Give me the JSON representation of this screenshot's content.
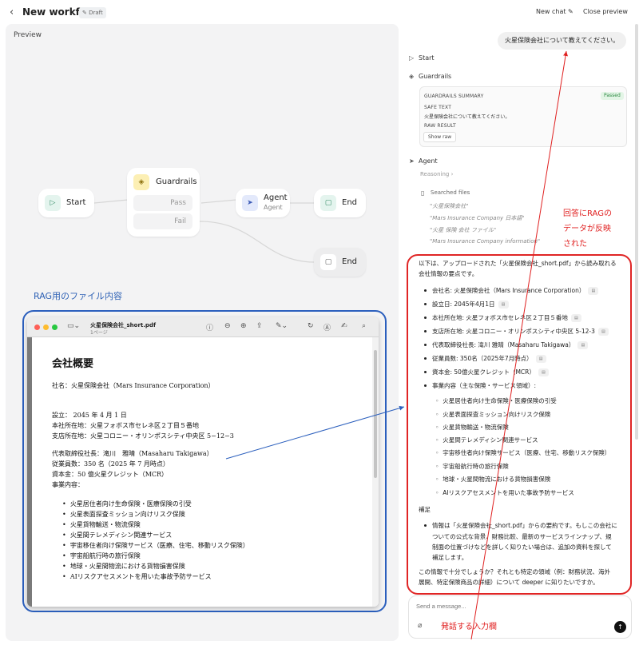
{
  "header": {
    "back_icon": "chevron-left-icon",
    "title": "New workflow",
    "draft_badge": "Draft",
    "new_chat": "New chat",
    "close_preview": "Close preview"
  },
  "preview": {
    "label": "Preview",
    "nodes": {
      "start": "Start",
      "guardrails": "Guardrails",
      "pass": "Pass",
      "fail": "Fail",
      "agent": "Agent",
      "agent_sub": "Agent",
      "end1": "End",
      "end2": "End"
    },
    "rag_label": "RAG用のファイル内容"
  },
  "pdf": {
    "filename": "火星保険会社_short.pdf",
    "pages": "1ページ",
    "title": "会社概要",
    "company": "社名：火星保険会社（Mars Insurance Corporation）",
    "established": "設立： 2045 年 4 月 1 日",
    "hq": "本社所在地：火星フォボス市セレネ区２丁目５番地",
    "branch": "支店所在地：火星コロニー・オリンポスシティ中央区 5−12−3",
    "ceo": "代表取締役社長：滝川　雅晴（Masaharu Takigawa）",
    "employees": "従業員数：350 名（2025 年 7 月時点）",
    "capital": "資本金：50 億火星クレジット（MCR）",
    "business_head": "事業内容：",
    "business": [
      "火星居住者向け生命保険・医療保険の引受",
      "火星表面探査ミッション向けリスク保険",
      "火星貨物輸送・物流保険",
      "火星間テレメディシン関連サービス",
      "宇宙移住者向け保険サービス（医療、住宅、移動リスク保険）",
      "宇宙船航行時の旅行保険",
      "地球・火星間物流における貨物損害保険",
      "AIリスクアセスメントを用いた事故予防サービス"
    ]
  },
  "chat": {
    "user_message": "火星保険会社について教えてください。",
    "start": "Start",
    "guardrails": "Guardrails",
    "summary_title": "GUARDRAILS SUMMARY",
    "passed": "Passed",
    "safe_text_label": "SAFE TEXT",
    "safe_text": "火星保険会社について教えてください。",
    "raw_result_label": "RAW RESULT",
    "show_raw": "Show raw",
    "agent": "Agent",
    "reasoning": "Reasoning",
    "searched_files": "Searched files",
    "queries": [
      "\"火星保険会社\"",
      "\"Mars Insurance Company 日本語\"",
      "\"火星 保険 会社 ファイル\"",
      "\"Mars Insurance Company information\""
    ],
    "annotation_answer": [
      "回答にRAGの",
      "データが反映",
      "された"
    ],
    "answer_intro": [
      "以下は、アップロードされた「火星保険会社_short.pdf」から読み取れる",
      "会社情報の要点です。"
    ],
    "answer_items": [
      "会社名: 火星保険会社（Mars Insurance Corporation）",
      "設立日: 2045年4月1日",
      "本社所在地: 火星フォボス市セレネ区２丁目５番地",
      "支店所在地: 火星コロニー・オリンポスシティ中央区 5-12-3",
      "代表取締役社長: 滝川 雅晴（Masaharu Takigawa）",
      "従業員数: 350名（2025年7月時点）",
      "資本金: 50億火星クレジット（MCR）",
      "事業内容（主な保険・サービス領域）:"
    ],
    "answer_sub_items": [
      "火星居住者向け生命保険・医療保険の引受",
      "火星表面探査ミッション向けリスク保険",
      "火星貨物輸送・物流保険",
      "火星間テレメディシン関連サービス",
      "宇宙移住者向け保険サービス（医療、住宅、移動リスク保険）",
      "宇宙船航行時の旅行保険",
      "地球・火星間物流における貨物損害保険",
      "AIリスクアセスメントを用いた事故予防サービス"
    ],
    "supplement_head": "補足",
    "supplement": [
      "情報は「火星保険会社_short.pdf」からの要約です。もしこの会社に",
      "ついての公式な背景、財務比較、最新のサービスラインナップ、規",
      "制面の位置づけなどを詳しく知りたい場合は、追加の資料を探して",
      "補足します。"
    ],
    "closing": [
      "この情報で十分でしょうか？それとも特定の領域（例：財務状況、海外",
      "展開、特定保険商品の詳細）について deeper に知りたいですか。"
    ],
    "input_placeholder": "Send a message...",
    "annotation_input": "発話する入力欄"
  },
  "colors": {
    "annotation_red": "#e02020",
    "annotation_blue": "#2b5fbd"
  }
}
